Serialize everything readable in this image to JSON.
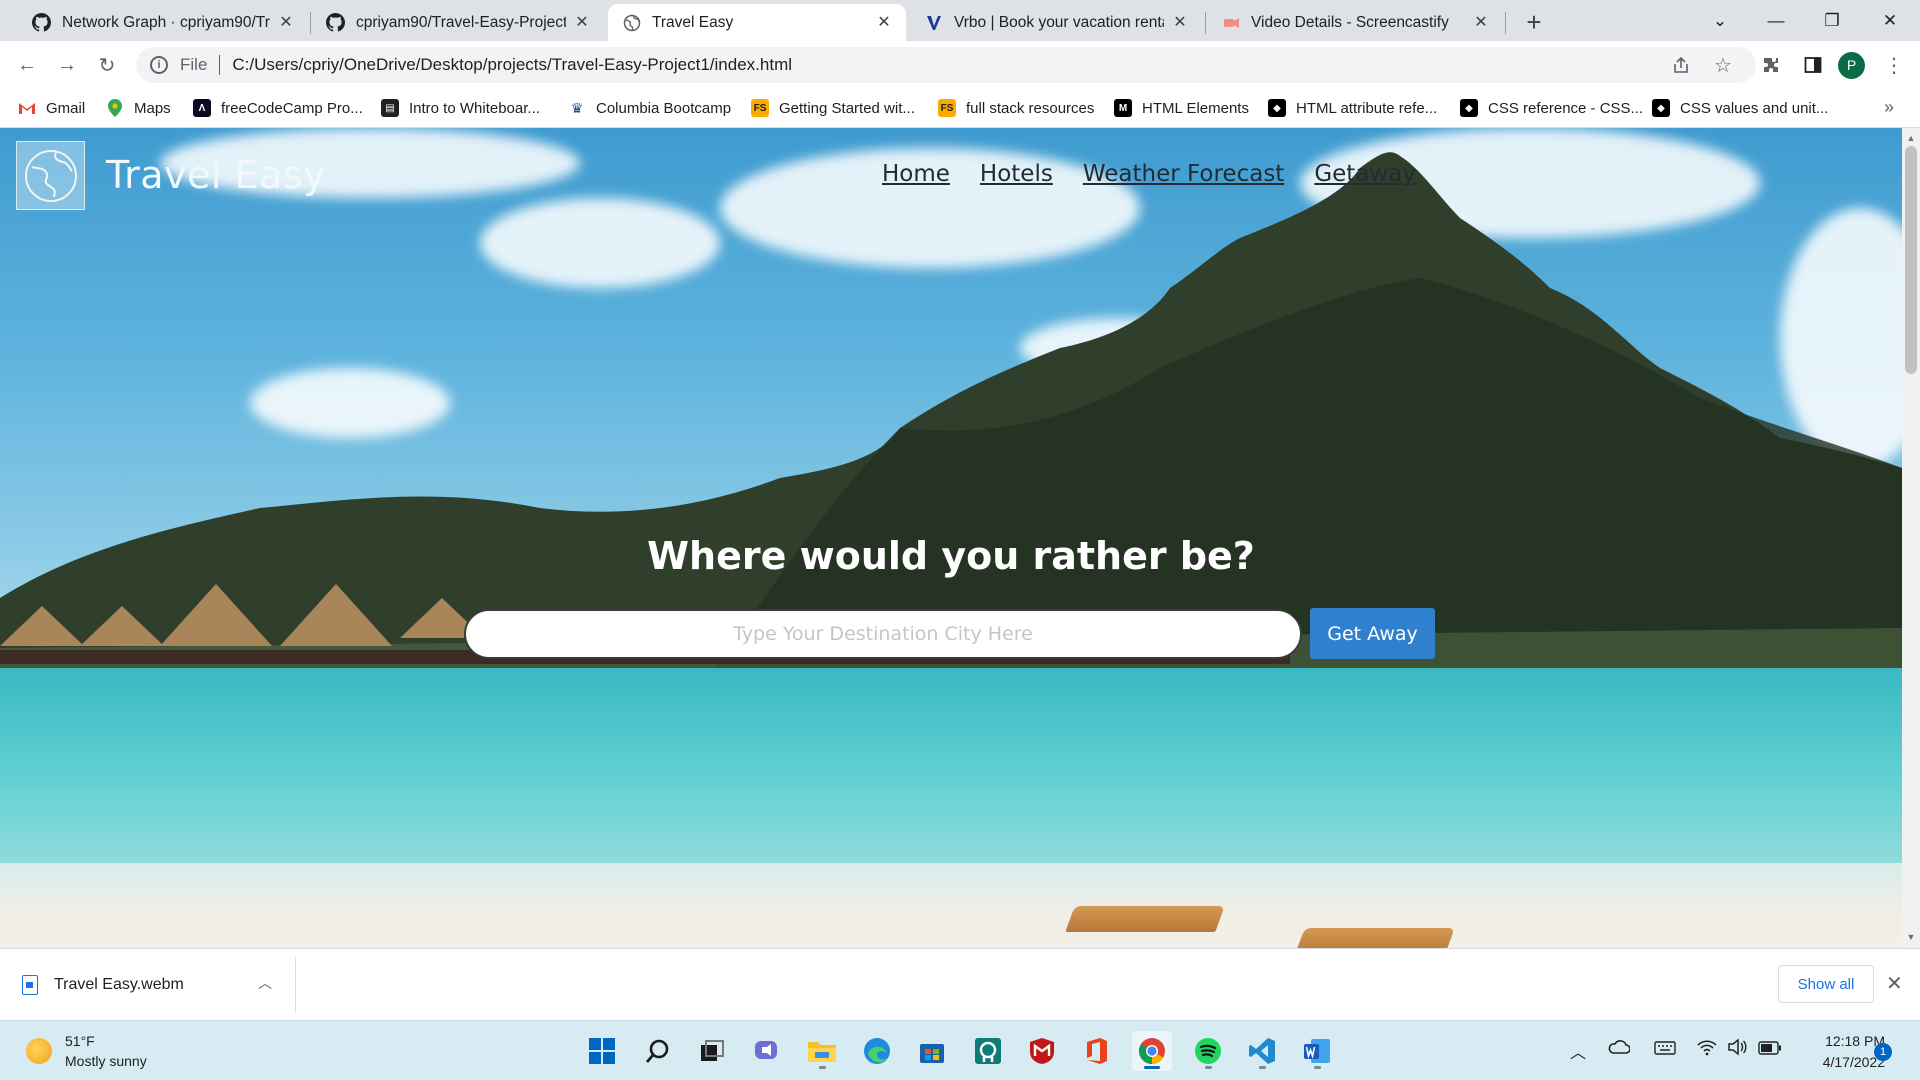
{
  "browser": {
    "tabs": [
      {
        "title": "Network Graph · cpriyam90/Trave",
        "icon": "github-icon"
      },
      {
        "title": "cpriyam90/Travel-Easy-Project1",
        "icon": "github-icon"
      },
      {
        "title": "Travel Easy",
        "icon": "globe-icon",
        "active": true
      },
      {
        "title": "Vrbo | Book your vacation rentals",
        "icon": "vrbo-icon"
      },
      {
        "title": "Video Details - Screencastify",
        "icon": "screencastify-icon"
      }
    ],
    "address": {
      "scheme": "File",
      "url": "C:/Users/cpriy/OneDrive/Desktop/projects/Travel-Easy-Project1/index.html"
    },
    "profile_initial": "P",
    "bookmarks": [
      {
        "label": "Gmail",
        "icon": "gmail-icon"
      },
      {
        "label": "Maps",
        "icon": "maps-icon"
      },
      {
        "label": "freeCodeCamp Pro...",
        "icon": "freecodecamp-icon"
      },
      {
        "label": "Intro to Whiteboar...",
        "icon": "notebook-icon"
      },
      {
        "label": "Columbia Bootcamp",
        "icon": "columbia-icon"
      },
      {
        "label": "Getting Started wit...",
        "icon": "fs-icon"
      },
      {
        "label": "full stack resources",
        "icon": "fs-icon"
      },
      {
        "label": "HTML Elements",
        "icon": "mdn-icon"
      },
      {
        "label": "HTML attribute refe...",
        "icon": "devdocs-icon"
      },
      {
        "label": "CSS reference - CSS...",
        "icon": "devdocs-icon"
      },
      {
        "label": "CSS values and unit...",
        "icon": "devdocs-icon"
      }
    ]
  },
  "site": {
    "title": "Travel Easy",
    "nav": [
      "Home",
      "Hotels",
      "Weather Forecast",
      "Getaway"
    ],
    "heading": "Where would you rather be?",
    "search_placeholder": "Type Your Destination City Here",
    "search_button": "Get Away"
  },
  "downloads": {
    "file": "Travel Easy.webm",
    "show_all": "Show all"
  },
  "taskbar": {
    "weather_temp": "51°F",
    "weather_desc": "Mostly sunny",
    "time": "12:18 PM",
    "date": "4/17/2022",
    "notifications": "1"
  },
  "colors": {
    "accent": "#2f80cf",
    "taskbar": "#d6ecf2",
    "chrome_tabstrip": "#dee1e6"
  }
}
